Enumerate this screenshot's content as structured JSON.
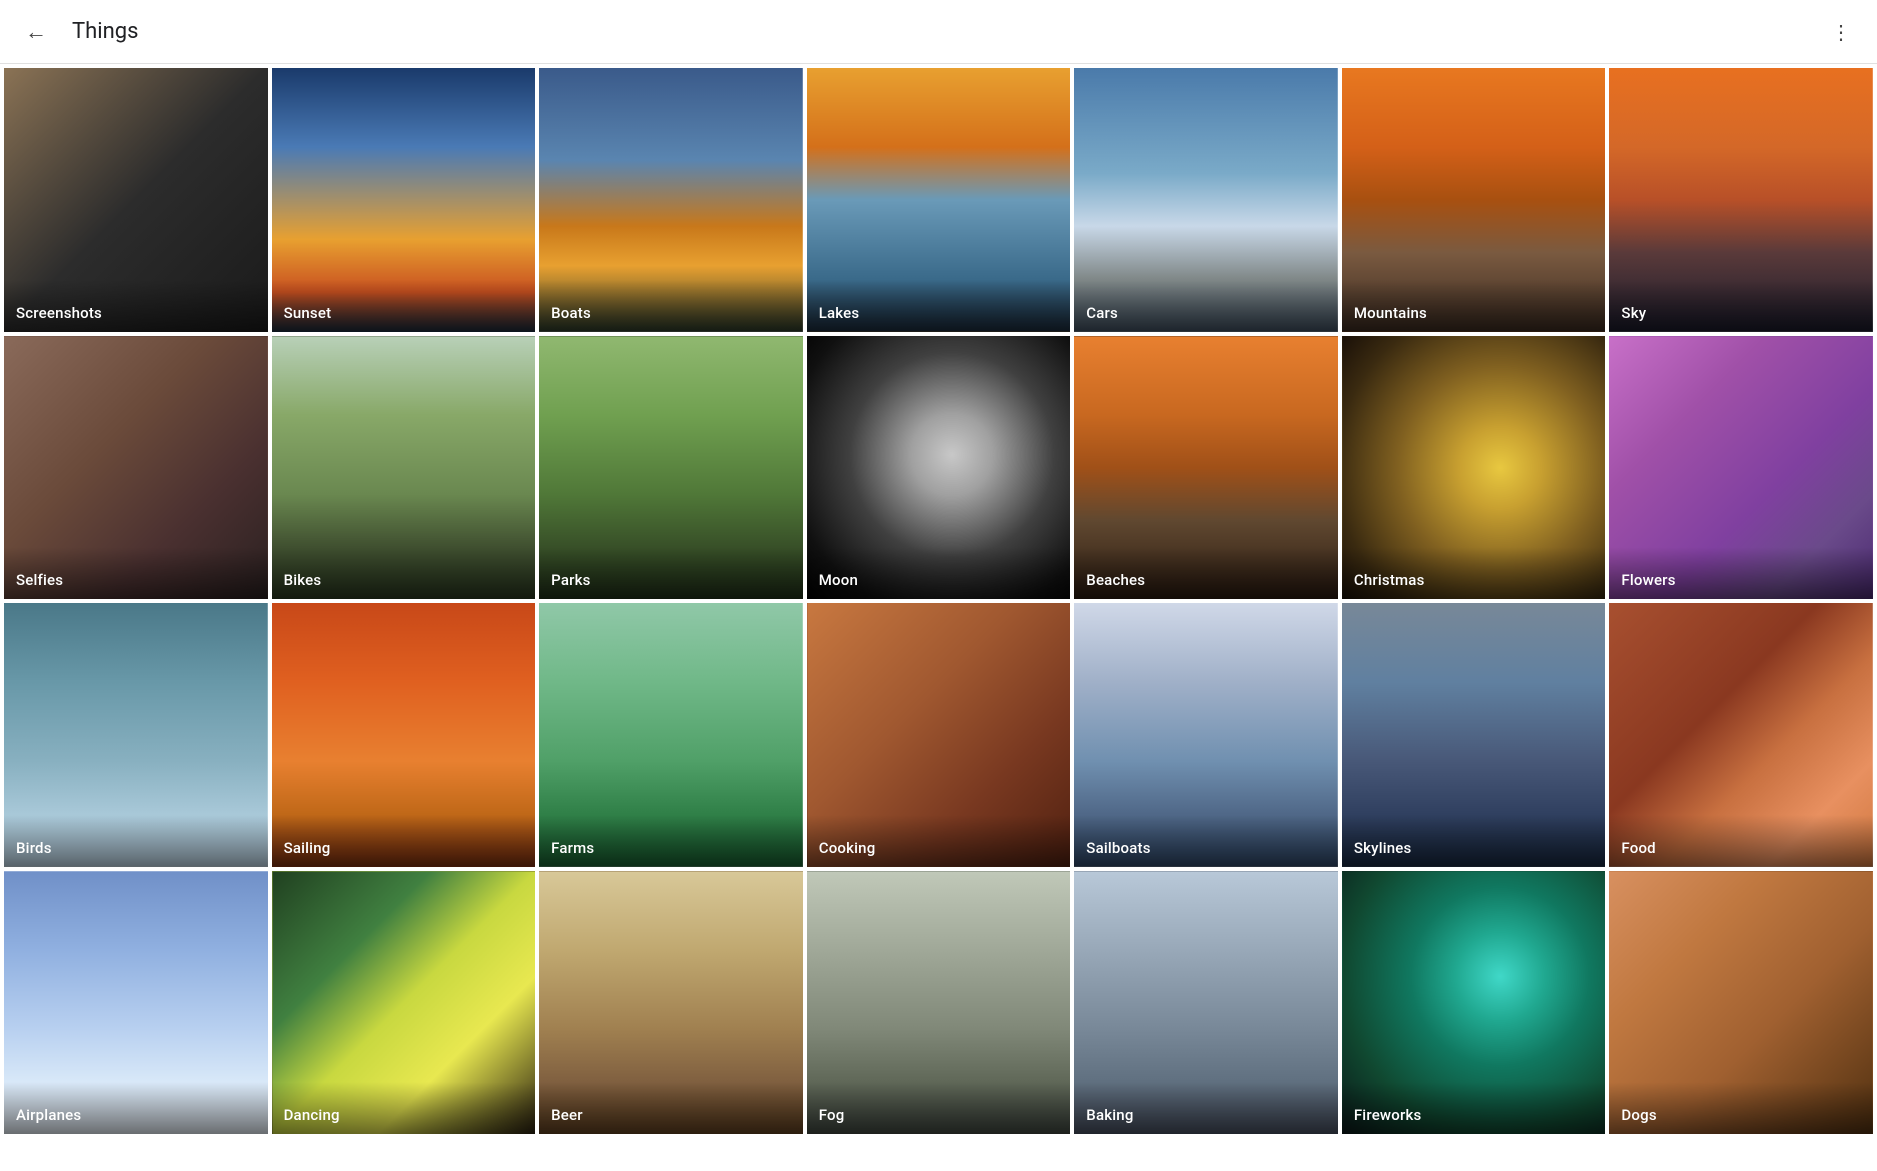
{
  "header": {
    "title": "Things",
    "back_label": "←",
    "more_label": "⋮"
  },
  "grid": {
    "tiles": [
      {
        "id": "screenshots",
        "label": "Screenshots",
        "class": "tile-screenshots"
      },
      {
        "id": "sunset",
        "label": "Sunset",
        "class": "tile-sunset"
      },
      {
        "id": "boats",
        "label": "Boats",
        "class": "tile-boats"
      },
      {
        "id": "lakes",
        "label": "Lakes",
        "class": "tile-lakes"
      },
      {
        "id": "cars",
        "label": "Cars",
        "class": "tile-cars"
      },
      {
        "id": "mountains",
        "label": "Mountains",
        "class": "tile-mountains"
      },
      {
        "id": "sky",
        "label": "Sky",
        "class": "tile-sky"
      },
      {
        "id": "selfies",
        "label": "Selfies",
        "class": "tile-selfies"
      },
      {
        "id": "bikes",
        "label": "Bikes",
        "class": "tile-bikes"
      },
      {
        "id": "parks",
        "label": "Parks",
        "class": "tile-parks"
      },
      {
        "id": "moon",
        "label": "Moon",
        "class": "tile-moon"
      },
      {
        "id": "beaches",
        "label": "Beaches",
        "class": "tile-beaches"
      },
      {
        "id": "christmas",
        "label": "Christmas",
        "class": "tile-christmas"
      },
      {
        "id": "flowers",
        "label": "Flowers",
        "class": "tile-flowers"
      },
      {
        "id": "birds",
        "label": "Birds",
        "class": "tile-birds"
      },
      {
        "id": "sailing",
        "label": "Sailing",
        "class": "tile-sailing"
      },
      {
        "id": "farms",
        "label": "Farms",
        "class": "tile-farms"
      },
      {
        "id": "cooking",
        "label": "Cooking",
        "class": "tile-cooking"
      },
      {
        "id": "sailboats",
        "label": "Sailboats",
        "class": "tile-sailboats"
      },
      {
        "id": "skylines",
        "label": "Skylines",
        "class": "tile-skylines"
      },
      {
        "id": "food",
        "label": "Food",
        "class": "tile-food"
      },
      {
        "id": "airplanes",
        "label": "Airplanes",
        "class": "tile-airplanes"
      },
      {
        "id": "dancing",
        "label": "Dancing",
        "class": "tile-dancing"
      },
      {
        "id": "beer",
        "label": "Beer",
        "class": "tile-beer"
      },
      {
        "id": "fog",
        "label": "Fog",
        "class": "tile-fog"
      },
      {
        "id": "baking",
        "label": "Baking",
        "class": "tile-baking"
      },
      {
        "id": "fireworks",
        "label": "Fireworks",
        "class": "tile-fireworks"
      },
      {
        "id": "dogs",
        "label": "Dogs",
        "class": "tile-dogs"
      }
    ]
  }
}
